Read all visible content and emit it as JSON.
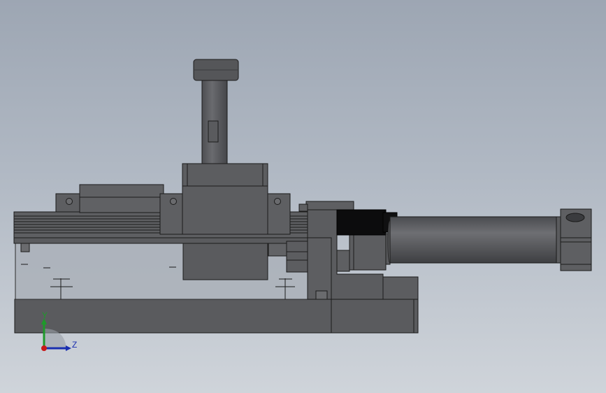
{
  "view": {
    "background_top": "#9da6b3",
    "background_bottom": "#cfd4da",
    "part_color": "#5c5d60",
    "edge_color": "#1b1b1b",
    "glass_color": "#aab0b8"
  },
  "triad": {
    "y_label": "Y",
    "z_label": "Z",
    "y_color": "#1e9a2a",
    "z_color": "#1a2fb0",
    "origin_color": "#c81818"
  }
}
